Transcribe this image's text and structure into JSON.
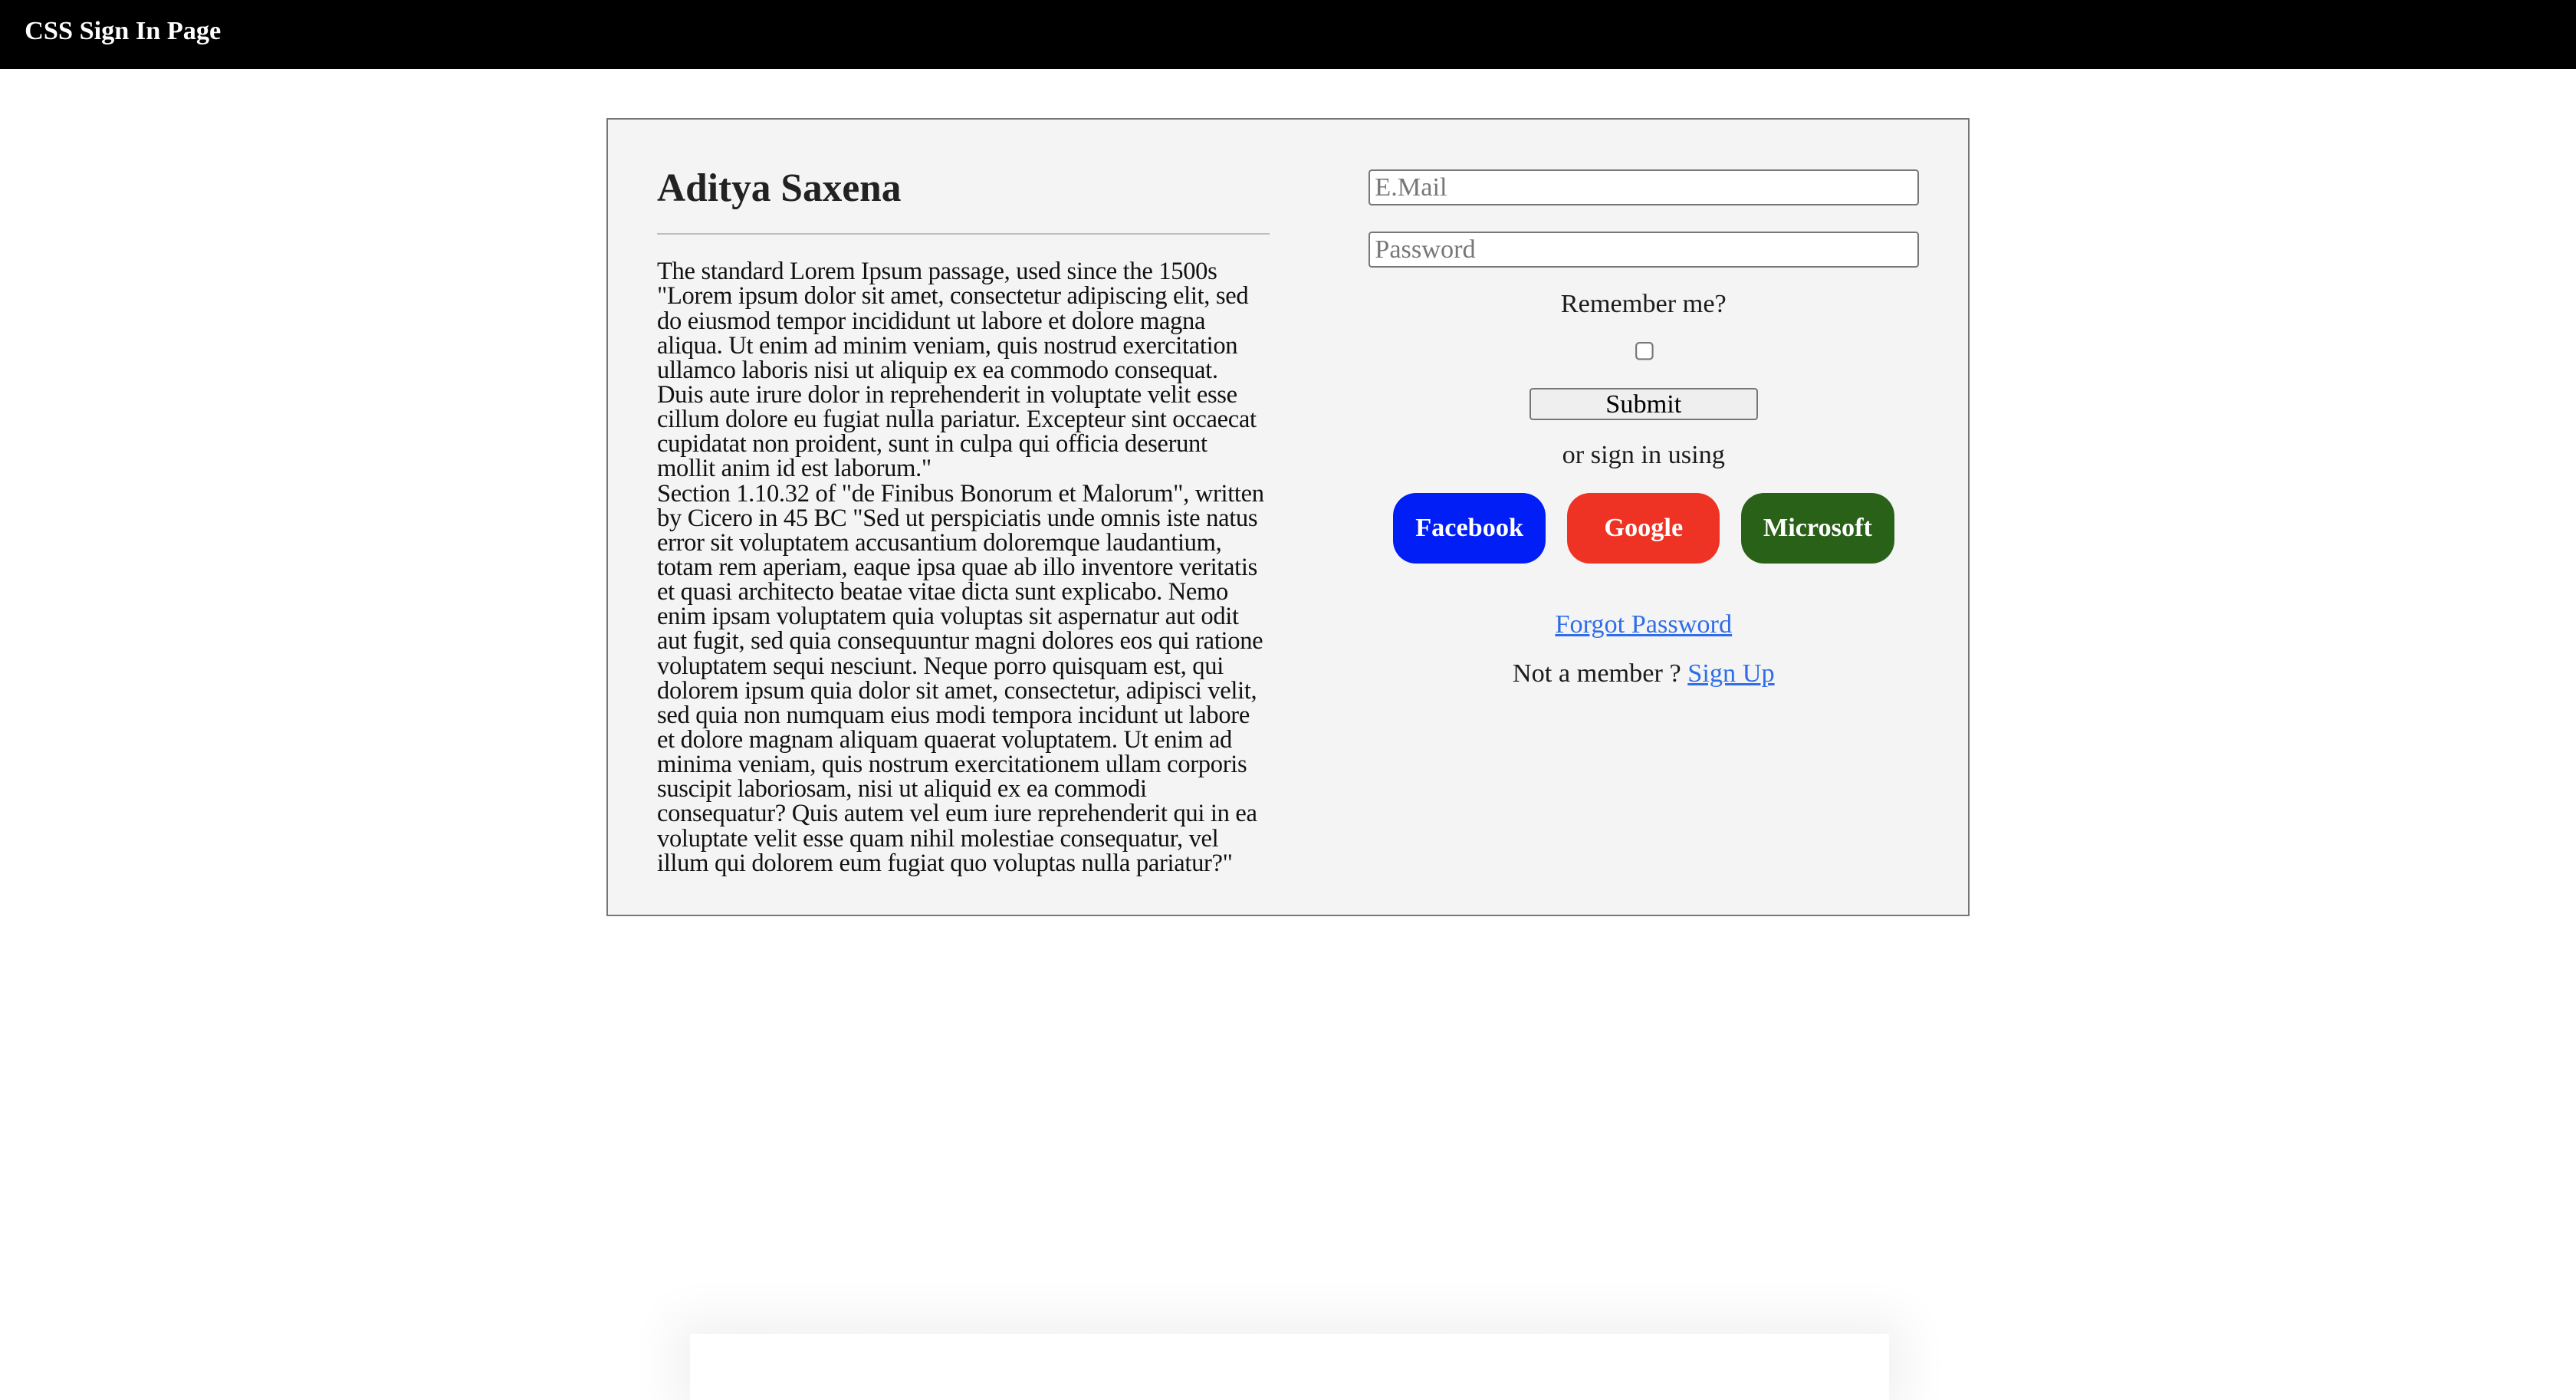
{
  "header": {
    "title": "CSS Sign In Page"
  },
  "left": {
    "name": "Aditya Saxena",
    "paragraph": "The standard Lorem Ipsum passage, used since the 1500s \"Lorem ipsum dolor sit amet, consectetur adipiscing elit, sed do eiusmod tempor incididunt ut labore et dolore magna aliqua. Ut enim ad minim veniam, quis nostrud exercitation ullamco laboris nisi ut aliquip ex ea commodo consequat. Duis aute irure dolor in reprehenderit in voluptate velit esse cillum dolore eu fugiat nulla pariatur. Excepteur sint occaecat cupidatat non proident, sunt in culpa qui officia deserunt mollit anim id est laborum.\"",
    "paragraph2": "Section 1.10.32 of \"de Finibus Bonorum et Malorum\", written by Cicero in 45 BC \"Sed ut perspiciatis unde omnis iste natus error sit voluptatem accusantium doloremque laudantium, totam rem aperiam, eaque ipsa quae ab illo inventore veritatis et quasi architecto beatae vitae dicta sunt explicabo. Nemo enim ipsam voluptatem quia voluptas sit aspernatur aut odit aut fugit, sed quia consequuntur magni dolores eos qui ratione voluptatem sequi nesciunt. Neque porro quisquam est, qui dolorem ipsum quia dolor sit amet, consectetur, adipisci velit, sed quia non numquam eius modi tempora incidunt ut labore et dolore magnam aliquam quaerat voluptatem. Ut enim ad minima veniam, quis nostrum exercitationem ullam corporis suscipit laboriosam, nisi ut aliquid ex ea commodi consequatur? Quis autem vel eum iure reprehenderit qui in ea voluptate velit esse quam nihil molestiae consequatur, vel illum qui dolorem eum fugiat quo voluptas nulla pariatur?\""
  },
  "form": {
    "email_placeholder": "E.Mail",
    "password_placeholder": "Password",
    "remember_label": "Remember me?",
    "submit_label": "Submit",
    "or_label": "or sign in using",
    "social": [
      {
        "label": "Facebook",
        "color": "#001ef5"
      },
      {
        "label": "Google",
        "color": "#ee3324"
      },
      {
        "label": "Microsoft",
        "color": "#2a6118"
      }
    ],
    "forgot_label": "Forgot Password",
    "not_member_label": "Not a member ?",
    "signup_label": "Sign Up"
  }
}
